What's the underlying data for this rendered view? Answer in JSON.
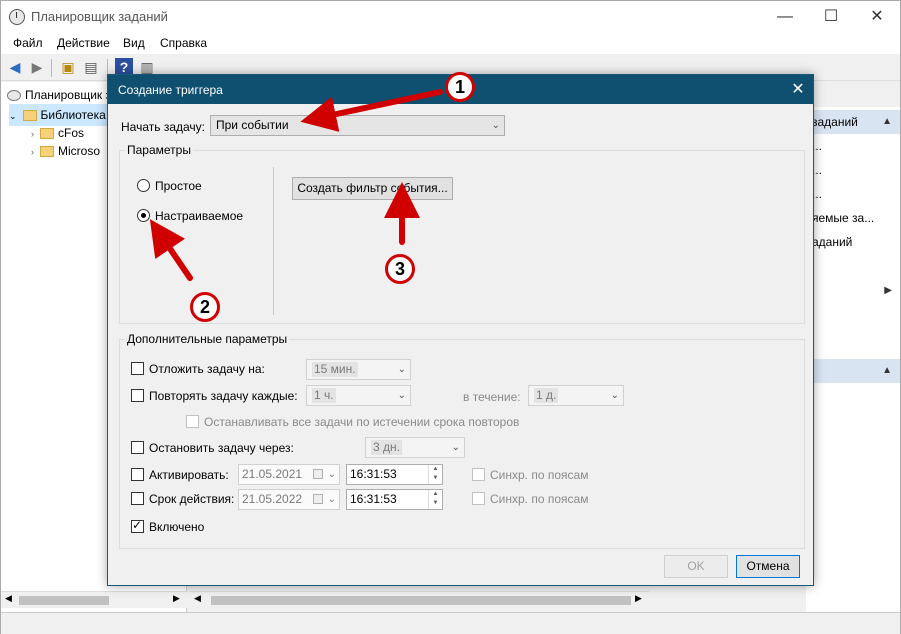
{
  "window": {
    "title": "Планировщик заданий",
    "minimize": "—",
    "maximize": "☐",
    "close": "✕"
  },
  "menu": [
    "Файл",
    "Действие",
    "Вид",
    "Справка"
  ],
  "tree": {
    "root": "Планировщик за",
    "library": "Библиотека",
    "children": [
      "cFos",
      "Microso"
    ]
  },
  "right_pane": {
    "section1_title": "заданий",
    "items": [
      "...",
      "...",
      "...",
      "яемые за...",
      "аданий"
    ],
    "section2_title": ""
  },
  "dialog": {
    "title": "Создание триггера",
    "close": "✕",
    "start_task_label": "Начать задачу:",
    "start_task_value": "При событии",
    "params_group": "Параметры",
    "radio_simple": "Простое",
    "radio_custom": "Настраиваемое",
    "radio_custom_selected": true,
    "create_filter_button": "Создать фильтр события...",
    "advanced_group": "Дополнительные параметры",
    "delay_label": "Отложить задачу на:",
    "delay_value": "15 мин.",
    "repeat_label": "Повторять задачу каждые:",
    "repeat_value": "1 ч.",
    "during_label": "в течение:",
    "during_value": "1 д.",
    "stop_all_label": "Останавливать все задачи по истечении срока повторов",
    "stop_after_label": "Остановить задачу через:",
    "stop_after_value": "3 дн.",
    "activate_label": "Активировать:",
    "activate_date": "21.05.2021",
    "activate_time": "16:31:53",
    "expire_label": "Срок действия:",
    "expire_date": "21.05.2022",
    "expire_time": "16:31:53",
    "sync_label": "Синхр. по поясам",
    "enabled_label": "Включено",
    "enabled_checked": true,
    "ok_button": "OK",
    "cancel_button": "Отмена"
  },
  "annotations": {
    "marker1": "1",
    "marker2": "2",
    "marker3": "3",
    "color": "#d10000"
  }
}
